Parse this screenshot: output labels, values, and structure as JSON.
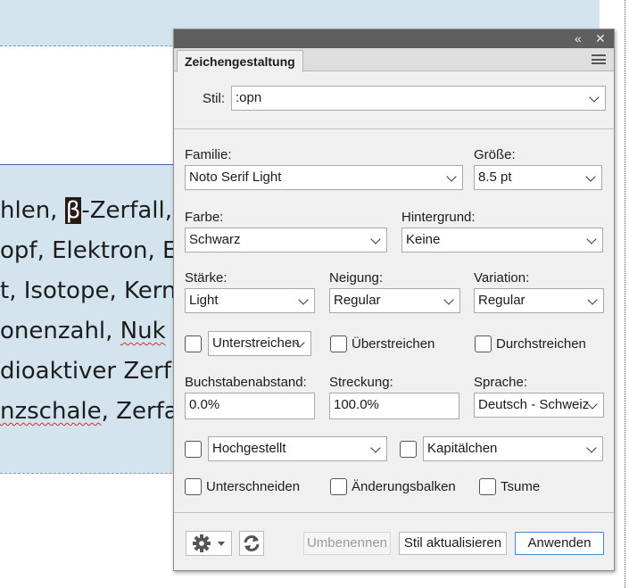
{
  "document": {
    "lines": [
      {
        "segments": [
          {
            "text": "hlen, "
          },
          {
            "text": "β",
            "style": "beta"
          },
          {
            "text": "-Zerfall, "
          }
        ]
      },
      {
        "segments": [
          {
            "text": "opf, Elektron, E"
          }
        ]
      },
      {
        "segments": [
          {
            "text": "t, Isotope, Kern"
          }
        ]
      },
      {
        "segments": [
          {
            "text": "onenzahl, "
          },
          {
            "text": "Nuk",
            "style": "squiggle"
          }
        ]
      },
      {
        "segments": [
          {
            "text": "dioaktiver Zerf"
          }
        ]
      },
      {
        "segments": [
          {
            "text": "nzschale",
            "style": "squiggle"
          },
          {
            "text": ", Zerfa"
          }
        ]
      }
    ]
  },
  "panel": {
    "title_buttons": {
      "collapse": "«",
      "close": "✕"
    },
    "tab": "Zeichengestaltung",
    "style": {
      "label": "Stil:",
      "value": ":opn"
    },
    "family": {
      "label": "Familie:",
      "value": "Noto Serif Light"
    },
    "size": {
      "label": "Größe:",
      "value": "8.5 pt"
    },
    "color": {
      "label": "Farbe:",
      "value": "Schwarz"
    },
    "background": {
      "label": "Hintergrund:",
      "value": "Keine"
    },
    "weight": {
      "label": "Stärke:",
      "value": "Light"
    },
    "slant": {
      "label": "Neigung:",
      "value": "Regular"
    },
    "variation": {
      "label": "Variation:",
      "value": "Regular"
    },
    "underline": {
      "value": "Unterstreichen",
      "checked": false
    },
    "overline": {
      "label": "Überstreichen",
      "checked": false
    },
    "strikethrough": {
      "label": "Durchstreichen",
      "checked": false
    },
    "tracking": {
      "label": "Buchstabenabstand:",
      "value": "0.0%"
    },
    "stretch": {
      "label": "Streckung:",
      "value": "100.0%"
    },
    "language": {
      "label": "Sprache:",
      "value": "Deutsch - Schweiz"
    },
    "position": {
      "value": "Hochgestellt",
      "checked": false
    },
    "capitals": {
      "value": "Kapitälchen",
      "checked": false
    },
    "kerning": {
      "label": "Unterschneiden",
      "checked": false
    },
    "changebars": {
      "label": "Änderungsbalken",
      "checked": false
    },
    "tsume": {
      "label": "Tsume",
      "checked": false
    },
    "buttons": {
      "settings": "gear-icon",
      "refresh": "refresh-icon",
      "rename": "Umbenennen",
      "update": "Stil aktualisieren",
      "apply": "Anwenden"
    },
    "colors": {
      "titlebar": "#5e5e5e",
      "panel_bg": "#f0f0f0",
      "primary_border": "#4a88c6"
    }
  }
}
